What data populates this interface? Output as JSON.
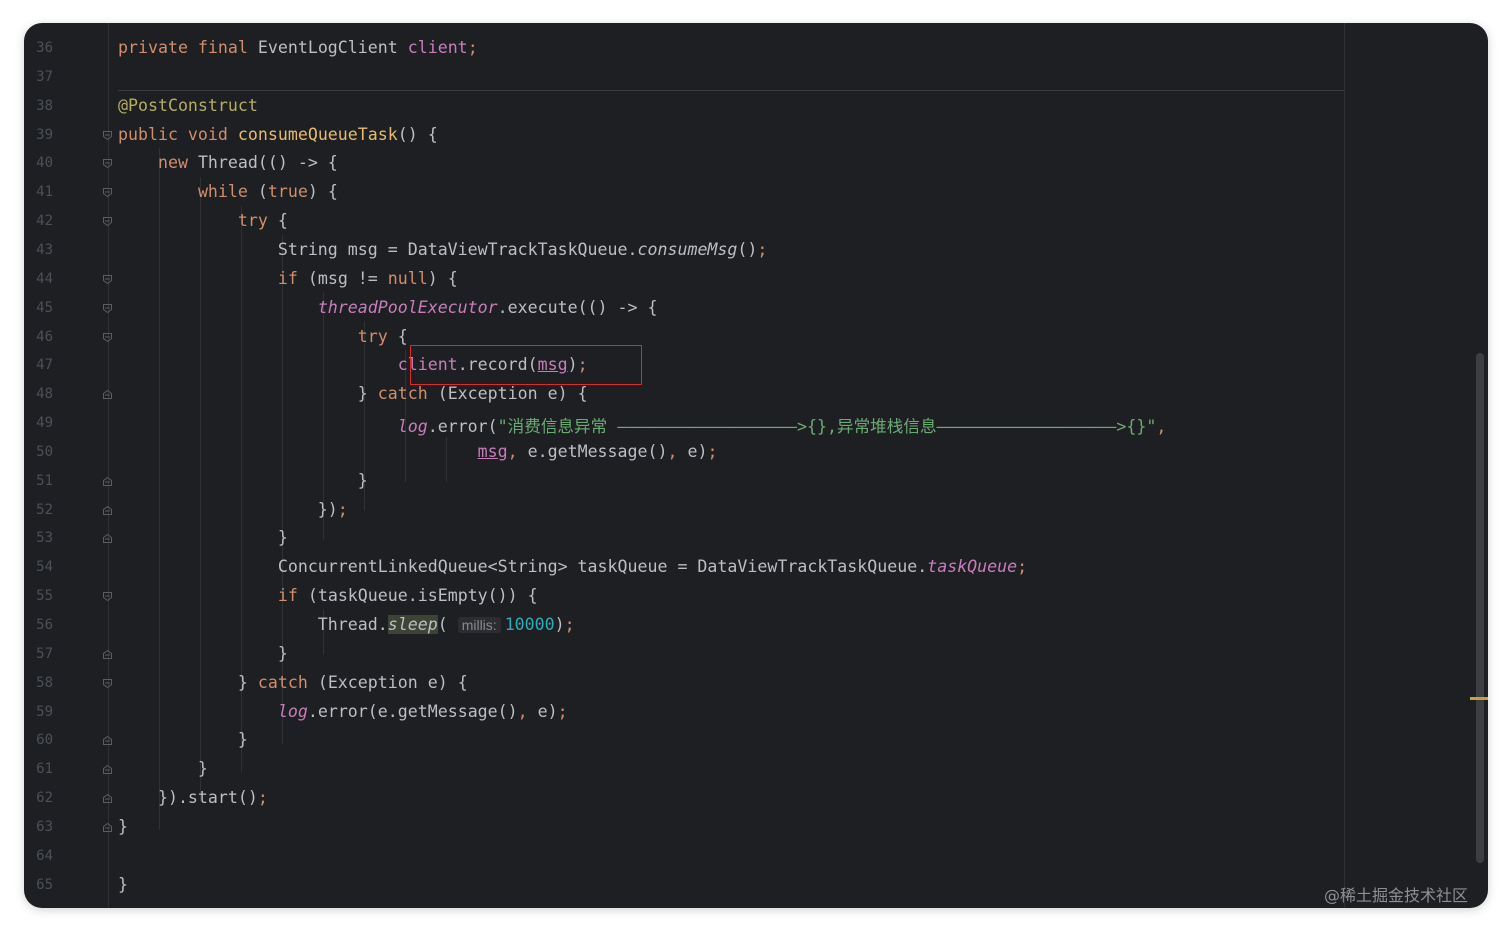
{
  "editor": {
    "lines": [
      {
        "num": "36",
        "fold": "none",
        "segments": [
          [
            "kw",
            "private final "
          ],
          [
            "t",
            "EventLogClient "
          ],
          [
            "field",
            "client"
          ],
          [
            "semi",
            ";"
          ]
        ]
      },
      {
        "num": "37",
        "fold": "none",
        "segments": []
      },
      {
        "num": "38",
        "fold": "none",
        "segments": [
          [
            "ann",
            "@PostConstruct"
          ]
        ]
      },
      {
        "num": "39",
        "fold": "open",
        "segments": [
          [
            "kw",
            "public void "
          ],
          [
            "method",
            "consumeQueueTask"
          ],
          [
            "t",
            "() {"
          ]
        ]
      },
      {
        "num": "40",
        "fold": "open",
        "segments": [
          [
            "t",
            "    "
          ],
          [
            "kw",
            "new "
          ],
          [
            "t",
            "Thread(() -> {"
          ]
        ]
      },
      {
        "num": "41",
        "fold": "open",
        "segments": [
          [
            "t",
            "        "
          ],
          [
            "kw",
            "while "
          ],
          [
            "t",
            "("
          ],
          [
            "kw",
            "true"
          ],
          [
            "t",
            ") {"
          ]
        ]
      },
      {
        "num": "42",
        "fold": "open",
        "segments": [
          [
            "t",
            "            "
          ],
          [
            "kw",
            "try "
          ],
          [
            "t",
            "{"
          ]
        ]
      },
      {
        "num": "43",
        "fold": "none",
        "segments": [
          [
            "t",
            "                String msg = DataViewTrackTaskQueue."
          ],
          [
            "static-call",
            "consumeMsg"
          ],
          [
            "t",
            "()"
          ],
          [
            "semi",
            ";"
          ]
        ]
      },
      {
        "num": "44",
        "fold": "open",
        "segments": [
          [
            "t",
            "                "
          ],
          [
            "kw",
            "if "
          ],
          [
            "t",
            "(msg != "
          ],
          [
            "kw",
            "null"
          ],
          [
            "t",
            ") {"
          ]
        ]
      },
      {
        "num": "45",
        "fold": "open",
        "segments": [
          [
            "t",
            "                    "
          ],
          [
            "static-field",
            "threadPoolExecutor"
          ],
          [
            "t",
            ".execute(() -> {"
          ]
        ]
      },
      {
        "num": "46",
        "fold": "open",
        "segments": [
          [
            "t",
            "                        "
          ],
          [
            "kw",
            "try "
          ],
          [
            "t",
            "{"
          ]
        ]
      },
      {
        "num": "47",
        "fold": "none",
        "segments": [
          [
            "t",
            "                            "
          ],
          [
            "field",
            "client"
          ],
          [
            "t",
            ".record("
          ],
          [
            "reassigned",
            "msg"
          ],
          [
            "t",
            ")"
          ],
          [
            "semi",
            ";"
          ]
        ]
      },
      {
        "num": "48",
        "fold": "close",
        "segments": [
          [
            "t",
            "                        } "
          ],
          [
            "kw",
            "catch "
          ],
          [
            "t",
            "(Exception e) {"
          ]
        ]
      },
      {
        "num": "49",
        "fold": "none",
        "segments": [
          [
            "t",
            "                            "
          ],
          [
            "static-field",
            "log"
          ],
          [
            "t",
            ".error("
          ],
          [
            "str",
            "\"消费信息异常 ——————————————————>{},异常堆栈信息——————————————————>{}\""
          ],
          [
            "semi",
            ","
          ]
        ]
      },
      {
        "num": "50",
        "fold": "none",
        "segments": [
          [
            "t",
            "                                    "
          ],
          [
            "reassigned",
            "msg"
          ],
          [
            "semi",
            ", "
          ],
          [
            "t",
            "e.getMessage()"
          ],
          [
            "semi",
            ", "
          ],
          [
            "t",
            "e)"
          ],
          [
            "semi",
            ";"
          ]
        ]
      },
      {
        "num": "51",
        "fold": "close",
        "segments": [
          [
            "t",
            "                        }"
          ]
        ]
      },
      {
        "num": "52",
        "fold": "close",
        "segments": [
          [
            "t",
            "                    })"
          ],
          [
            "semi",
            ";"
          ]
        ]
      },
      {
        "num": "53",
        "fold": "close",
        "segments": [
          [
            "t",
            "                }"
          ]
        ]
      },
      {
        "num": "54",
        "fold": "none",
        "segments": [
          [
            "t",
            "                ConcurrentLinkedQueue<String> taskQueue = DataViewTrackTaskQueue."
          ],
          [
            "static-field",
            "taskQueue"
          ],
          [
            "semi",
            ";"
          ]
        ]
      },
      {
        "num": "55",
        "fold": "open",
        "segments": [
          [
            "t",
            "                "
          ],
          [
            "kw",
            "if "
          ],
          [
            "t",
            "(taskQueue.isEmpty()) {"
          ]
        ]
      },
      {
        "num": "56",
        "fold": "none",
        "segments": [
          [
            "t",
            "                    Thread."
          ],
          [
            "sleep",
            "sleep"
          ],
          [
            "t",
            "( "
          ],
          [
            "hint",
            "millis:"
          ],
          [
            "num",
            "10000"
          ],
          [
            "t",
            ")"
          ],
          [
            "semi",
            ";"
          ]
        ]
      },
      {
        "num": "57",
        "fold": "close",
        "segments": [
          [
            "t",
            "                }"
          ]
        ]
      },
      {
        "num": "58",
        "fold": "open",
        "segments": [
          [
            "t",
            "            } "
          ],
          [
            "kw",
            "catch "
          ],
          [
            "t",
            "(Exception e) {"
          ]
        ]
      },
      {
        "num": "59",
        "fold": "none",
        "segments": [
          [
            "t",
            "                "
          ],
          [
            "static-field",
            "log"
          ],
          [
            "t",
            ".error(e.getMessage()"
          ],
          [
            "semi",
            ", "
          ],
          [
            "t",
            "e)"
          ],
          [
            "semi",
            ";"
          ]
        ]
      },
      {
        "num": "60",
        "fold": "close",
        "segments": [
          [
            "t",
            "            }"
          ]
        ]
      },
      {
        "num": "61",
        "fold": "close",
        "segments": [
          [
            "t",
            "        }"
          ]
        ]
      },
      {
        "num": "62",
        "fold": "close",
        "segments": [
          [
            "t",
            "    }).start()"
          ],
          [
            "semi",
            ";"
          ]
        ]
      },
      {
        "num": "63",
        "fold": "close",
        "segments": [
          [
            "t",
            "}"
          ]
        ]
      },
      {
        "num": "64",
        "fold": "none",
        "segments": []
      },
      {
        "num": "65",
        "fold": "none",
        "segments": [
          [
            "t",
            "}"
          ]
        ]
      }
    ],
    "colors": {
      "background": "#1e1f22",
      "keyword": "#cf8e6d",
      "annotation": "#b3ae60",
      "method": "#e8bb6e",
      "field": "#c77dbb",
      "string": "#6aab73",
      "number": "#2aacb8",
      "highlight_box": "#e02828"
    }
  },
  "watermark": "@稀土掘金技术社区"
}
